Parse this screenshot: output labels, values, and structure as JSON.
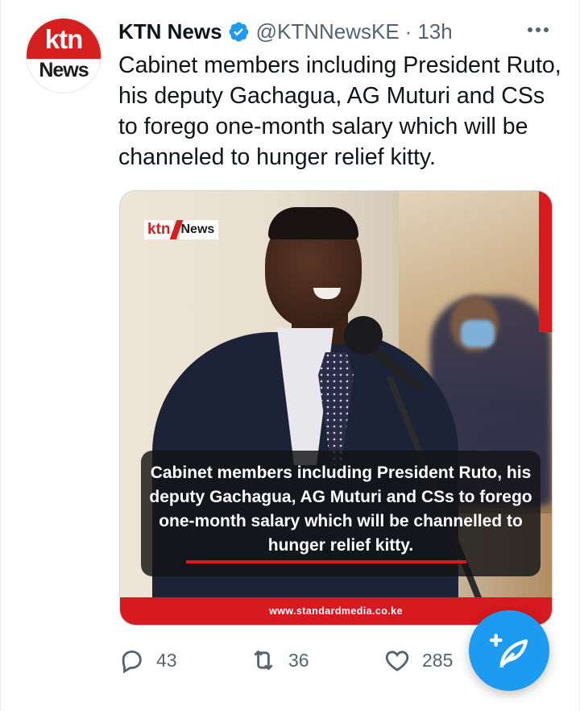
{
  "tweet": {
    "author_name": "KTN News",
    "handle": "@KTNNewsKE",
    "separator": "·",
    "time": "13h",
    "text": "Cabinet members including President Ruto, his deputy Gachagua, AG Muturi and CSs to forego one-month salary which will be channeled to hunger relief kitty.",
    "avatar": {
      "top_text": "ktn",
      "bottom_text": "News",
      "brand_color": "#d6201f"
    }
  },
  "media": {
    "logo_left": "ktn",
    "logo_right": "News",
    "caption": "Cabinet members including President Ruto, his deputy Gachagua, AG Muturi and CSs to forego one-month salary which will be channelled to hunger relief kitty.",
    "footer_url": "www.standardmedia.co.ke",
    "accent_color": "#d71920"
  },
  "actions": {
    "replies": "43",
    "retweets": "36",
    "likes": "285"
  },
  "icons": {
    "verified": "verified-badge-icon",
    "more": "more-horizontal-icon",
    "reply": "reply-icon",
    "retweet": "retweet-icon",
    "like": "heart-icon",
    "compose": "compose-tweet-icon"
  },
  "colors": {
    "twitter_blue": "#1d9bf0",
    "secondary_text": "#536471"
  }
}
